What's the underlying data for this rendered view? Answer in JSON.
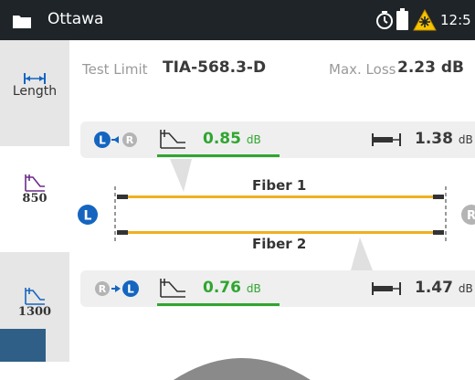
{
  "header": {
    "title": "Ottawa",
    "time": "12:5"
  },
  "sidebar": {
    "tabs": [
      {
        "label": "Length",
        "icon": "length-icon"
      },
      {
        "label": "850",
        "icon": "loss-icon"
      },
      {
        "label": "1300",
        "icon": "loss-icon"
      }
    ]
  },
  "main": {
    "test_limit_label": "Test Limit",
    "test_limit_value": "TIA-568.3-D",
    "max_loss_label": "Max. Loss",
    "max_loss_value": "2.23 dB",
    "top_measure": {
      "from": "L",
      "to": "R",
      "loss_value": "0.85",
      "loss_unit": "dB",
      "length_value": "1.38",
      "length_unit": "dB"
    },
    "bottom_measure": {
      "from": "R",
      "to": "L",
      "loss_value": "0.76",
      "loss_unit": "dB",
      "length_value": "1.47",
      "length_unit": "dB"
    },
    "fiber1_label": "Fiber 1",
    "fiber2_label": "Fiber 2",
    "left_end": "L",
    "right_end": "R"
  },
  "colors": {
    "accent_blue": "#1565c0",
    "pass_green": "#2fa62f",
    "fiber_orange": "#f0b020",
    "header_bg": "#1e2428",
    "warn_yellow": "#f5c400"
  }
}
